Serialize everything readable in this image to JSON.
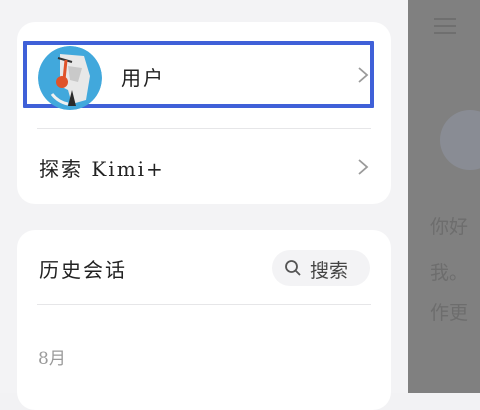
{
  "user": {
    "label": "用户"
  },
  "explore": {
    "label": "探索 Kimi+"
  },
  "history": {
    "title": "历史会话",
    "search_label": "搜索",
    "month": "8月"
  },
  "overlay": {
    "lines": [
      "你好",
      "我。",
      "作更"
    ]
  },
  "colors": {
    "highlight": "#3f60d8",
    "card": "#ffffff",
    "background": "#f3f3f5",
    "overlay": "#808080"
  },
  "icons": {
    "avatar": "avatar-portrait",
    "chevron": "chevron-right-icon",
    "search": "search-icon",
    "menu": "menu-icon"
  }
}
